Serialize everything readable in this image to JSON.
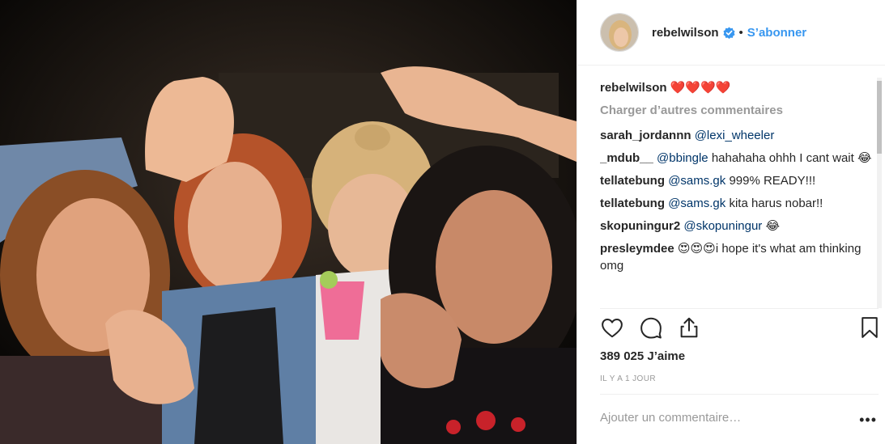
{
  "header": {
    "username": "rebelwilson",
    "separator": "•",
    "follow_label": "S’abonner"
  },
  "caption": {
    "username": "rebelwilson",
    "text": "❤️❤️❤️❤️"
  },
  "load_more_label": "Charger d’autres commentaires",
  "comments": [
    {
      "user": "sarah_jordannn",
      "mention": "@lexi_wheeler",
      "text": ""
    },
    {
      "user": "_mdub__",
      "mention": "@bbingle",
      "text": "hahahaha ohhh I cant wait 😂"
    },
    {
      "user": "tellatebung",
      "mention": "@sams.gk",
      "text": "999% READY!!!"
    },
    {
      "user": "tellatebung",
      "mention": "@sams.gk",
      "text": "kita harus nobar!!"
    },
    {
      "user": "skopuningur2",
      "mention": "@skopuningur",
      "text": "😂"
    },
    {
      "user": "presleymdee",
      "mention": "",
      "text": "😍😍😍i hope it's what am thinking omg"
    }
  ],
  "likes_text": "389 025 J’aime",
  "time_text": "IL Y A 1 JOUR",
  "add_comment_placeholder": "Ajouter un commentaire…",
  "more_label": "•••",
  "icons": {
    "like": "heart-icon",
    "comment": "comment-icon",
    "share": "share-icon",
    "save": "bookmark-icon",
    "verified": "verified-badge-icon"
  },
  "colors": {
    "link_blue": "#3897f0",
    "mention": "#003569",
    "muted": "#999999",
    "text": "#262626"
  }
}
